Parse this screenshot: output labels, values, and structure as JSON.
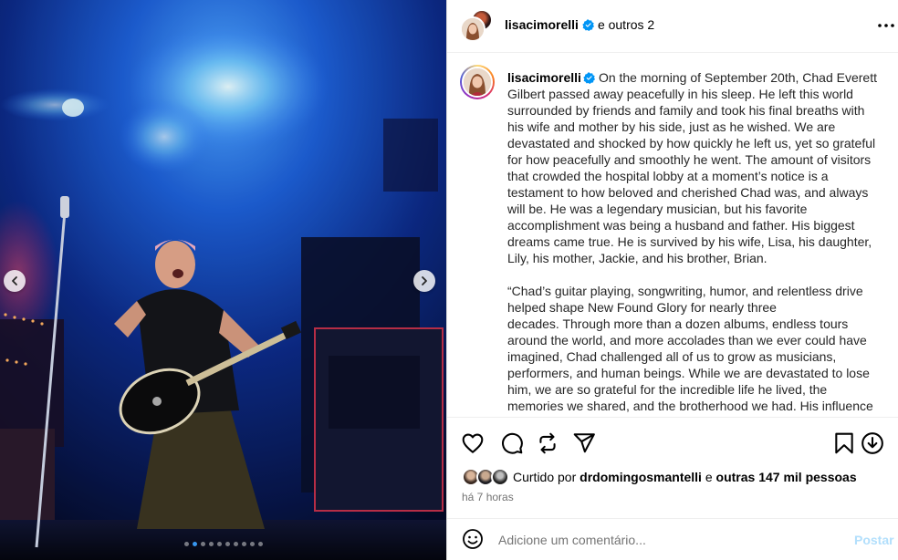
{
  "header": {
    "username": "lisacimorelli",
    "and_others": "e outros 2"
  },
  "caption": {
    "username": "lisacimorelli",
    "paragraphs": [
      [
        "On the morning of September 20th, Chad Everett",
        "Gilbert passed away peacefully in his sleep. He left this world",
        "surrounded by friends and family and took his final breaths with",
        "his wife and mother by his side, just as he wished. We are",
        "devastated and shocked by how quickly he left us, yet so grateful",
        "for how peacefully and smoothly he went. The amount of visitors",
        "that crowded the hospital lobby at a moment’s notice is a",
        "testament to how beloved and cherished Chad was, and always",
        "will be. He was a legendary musician, but his favorite",
        "accomplishment was being a husband and father. His biggest",
        "dreams came true. He is survived by his wife, Lisa, his daughter,",
        "Lily, his mother, Jackie, and his brother, Brian."
      ],
      [
        "“Chad’s guitar playing, songwriting, humor, and relentless drive",
        "helped shape New Found Glory for nearly three",
        "decades. Through more than a dozen albums, endless tours",
        "around the world, and more accolades than we ever could have",
        "imagined, Chad challenged all of us to grow as musicians,",
        "performers, and human beings. While we are devastated to lose",
        "him, we are so grateful for the incredible life he lived, the",
        "memories we shared, and the brotherhood we had. His influence"
      ]
    ]
  },
  "likes": {
    "prefix": "Curtido por",
    "user": "drdomingosmantelli",
    "connector": "e",
    "others": "outras 147 mil pessoas"
  },
  "time_ago": "há 7 horas",
  "comment": {
    "placeholder": "Adicione um comentário...",
    "post_label": "Postar"
  },
  "carousel": {
    "total_slides": 10,
    "active_index": 1
  },
  "colors": {
    "verified": "#0095f6",
    "post_disabled": "#b2dffc",
    "muted_text": "#737373",
    "carousel_active_dot": "#3897f0"
  },
  "icons": {
    "like": "heart-icon",
    "comment": "comment-bubble-icon",
    "repost": "repost-icon",
    "share": "paper-plane-icon",
    "save": "bookmark-icon",
    "download": "download-icon",
    "emoji": "smiley-icon",
    "more": "more-dots-icon",
    "verified": "verified-badge-icon",
    "prev": "chevron-left-icon",
    "next": "chevron-right-icon"
  }
}
